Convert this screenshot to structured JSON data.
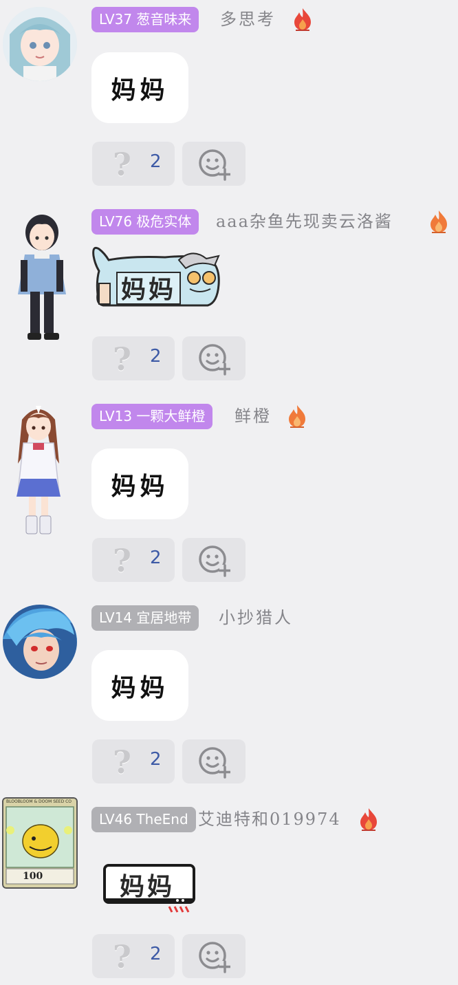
{
  "messages": [
    {
      "level_badge": "LV37 葱音味来",
      "badge_color": "#c187ec",
      "username": "多思考",
      "has_flame": true,
      "flame_style": "red",
      "content_type": "bubble",
      "content_text": "妈妈",
      "question_count": "2",
      "avatar": "anime-girl-avatar"
    },
    {
      "level_badge": "LV76 极危实体",
      "badge_color": "#c187ec",
      "username": "aaa杂鱼先现卖云洛酱",
      "has_flame": true,
      "flame_style": "orange",
      "content_type": "sticker",
      "content_text": "妈妈",
      "question_count": "2",
      "avatar": "boy-figure-avatar"
    },
    {
      "level_badge": "LV13 一颗大鲜橙",
      "badge_color": "#c187ec",
      "username": "鲜橙",
      "has_flame": true,
      "flame_style": "orange",
      "content_type": "bubble",
      "content_text": "妈妈",
      "question_count": "2",
      "avatar": "horse-girl-figure-avatar"
    },
    {
      "level_badge": "LV14 宜居地带",
      "badge_color": "#b0b0b4",
      "username": "小抄猎人",
      "has_flame": false,
      "content_type": "bubble",
      "content_text": "妈妈",
      "question_count": "2",
      "avatar": "blue-hair-boy-avatar"
    },
    {
      "level_badge": "LV46 TheEnd",
      "badge_color": "#b0b0b4",
      "username": "艾迪特和019974",
      "has_flame": true,
      "flame_style": "red",
      "content_type": "sticker-box",
      "content_text": "妈妈",
      "question_count": "2",
      "avatar": "card-avatar",
      "card_caption": "BLOOBLOOM & DOOM SEED CO",
      "card_value": "100"
    }
  ]
}
